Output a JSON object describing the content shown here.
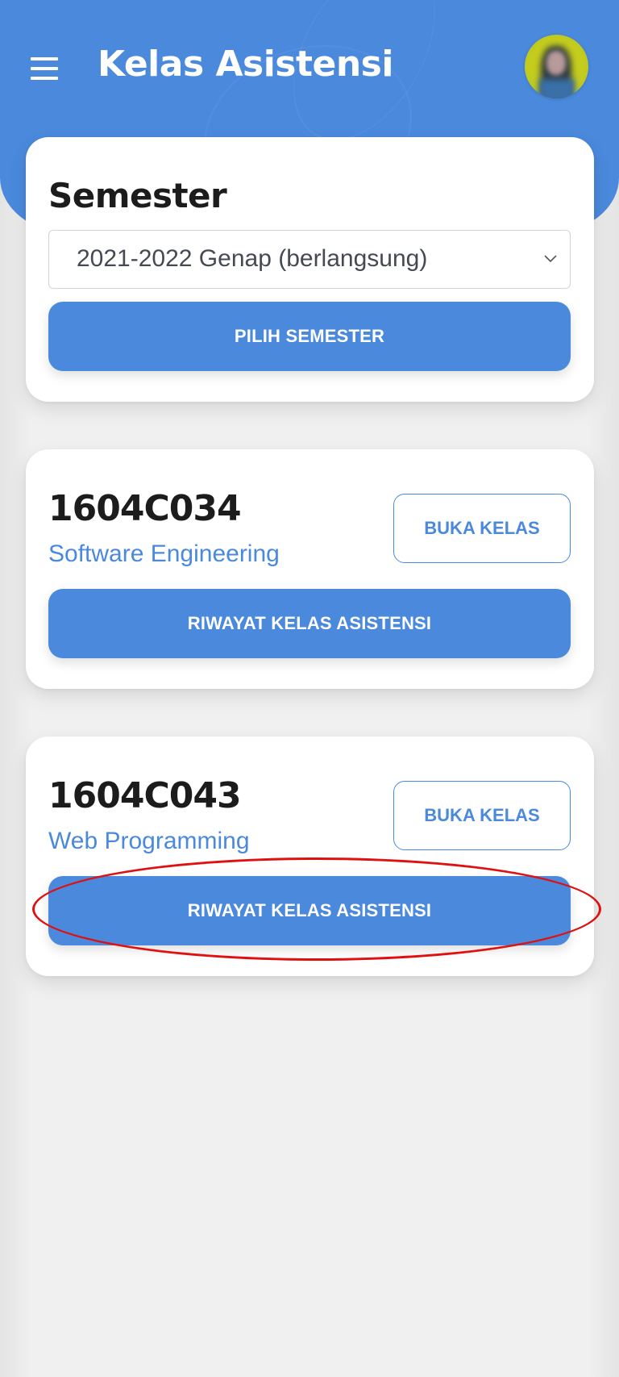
{
  "app_bar": {
    "title": "Kelas Asistensi",
    "menu_icon": "hamburger-menu-icon",
    "avatar": "user-avatar"
  },
  "semester": {
    "title": "Semester",
    "selected_value": "2021-2022 Genap (berlangsung)",
    "dropdown_icon": "chevron-down-icon",
    "button_label": "PILIH SEMESTER"
  },
  "classes": [
    {
      "code": "1604C034",
      "name": "Software Engineering",
      "open_button_label": "BUKA KELAS",
      "history_button_label": "RIWAYAT KELAS ASISTENSI"
    },
    {
      "code": "1604C043",
      "name": "Web Programming",
      "open_button_label": "BUKA KELAS",
      "history_button_label": "RIWAYAT KELAS ASISTENSI"
    }
  ],
  "colors": {
    "primary": "#4a89dc",
    "background": "#f0f0f0",
    "card": "#ffffff",
    "text_dark": "#1c1c1c",
    "annotation": "#e01010"
  }
}
